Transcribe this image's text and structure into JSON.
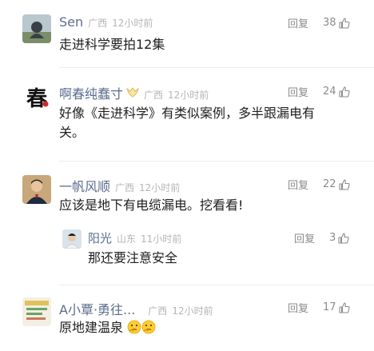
{
  "comments": [
    {
      "name": "Sen",
      "region": "广西",
      "time": "12小时前",
      "text": "走进科学要拍12集",
      "reply_label": "回复",
      "likes": "38"
    },
    {
      "name": "啊春纯蠢寸",
      "region": "广西",
      "time": "12小时前",
      "text_line1": "好像《走进科学》有类似案例，多半跟漏电有",
      "text_line2": "关。",
      "reply_label": "回复",
      "likes": "24",
      "avatar_text": "春"
    },
    {
      "name": "一帆风顺",
      "region": "广西",
      "time": "12小时前",
      "text": "应该是地下有电缆漏电。挖看看!",
      "reply_label": "回复",
      "likes": "22",
      "reply": {
        "name": "阳光",
        "region": "山东",
        "time": "11小时前",
        "text": "那还要注意安全",
        "reply_label": "回复",
        "likes": "3"
      }
    },
    {
      "name": "A小覃·勇往...",
      "region": "广西",
      "time": "12小时前",
      "text": "原地建温泉",
      "reply_label": "回复",
      "likes": "17"
    }
  ],
  "colors": {
    "name": "#5b6d8f",
    "meta": "#b5b5b5",
    "text": "#1f1f1f",
    "action": "#8b8b8b"
  },
  "icons": [
    "thumbs-up-icon",
    "vip-badge-icon",
    "thinking-emoji-icon"
  ]
}
